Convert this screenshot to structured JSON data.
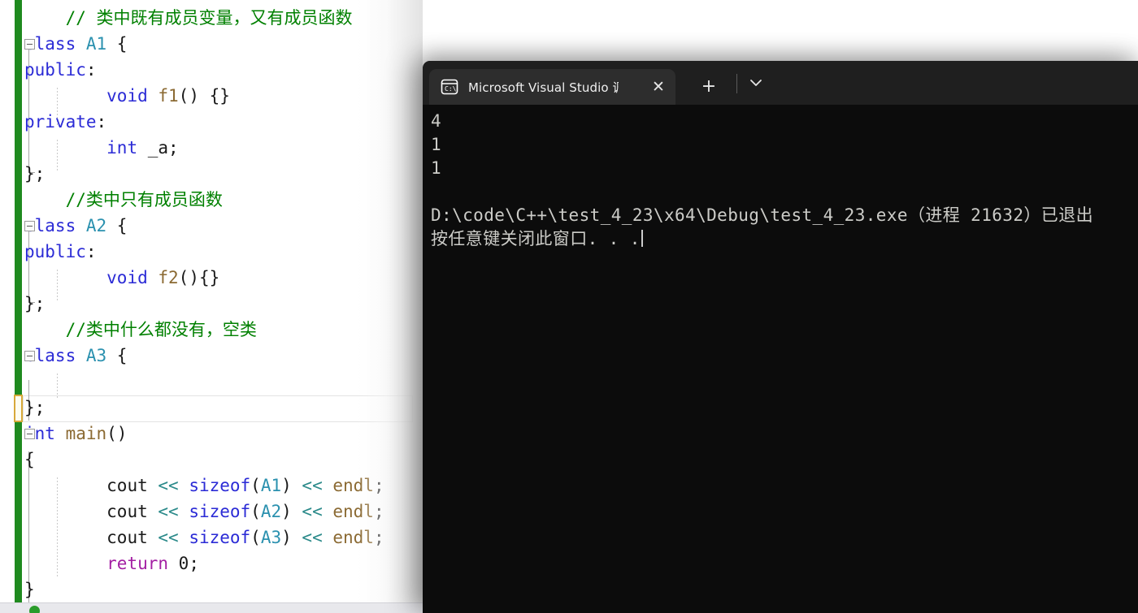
{
  "editor": {
    "name": "visual-studio-code-editor",
    "language": "cpp",
    "lines": [
      {
        "indent": 1,
        "tokens": [
          {
            "t": "// 类中既有成员变量，又有成员函数",
            "c": "t-comment"
          }
        ]
      },
      {
        "indent": 0,
        "fold": true,
        "tokens": [
          {
            "t": "class ",
            "c": "t-keyword"
          },
          {
            "t": "A1",
            "c": "t-class"
          },
          {
            "t": " {",
            "c": "t-brace"
          }
        ]
      },
      {
        "indent": 0,
        "tokens": [
          {
            "t": "public",
            "c": "t-keyword"
          },
          {
            "t": ":",
            "c": "t-plain"
          }
        ]
      },
      {
        "indent": 2,
        "tokens": [
          {
            "t": "void ",
            "c": "t-type"
          },
          {
            "t": "f1",
            "c": "t-func"
          },
          {
            "t": "() {}",
            "c": "t-brace"
          }
        ]
      },
      {
        "indent": 0,
        "tokens": [
          {
            "t": "private",
            "c": "t-keyword"
          },
          {
            "t": ":",
            "c": "t-plain"
          }
        ]
      },
      {
        "indent": 2,
        "tokens": [
          {
            "t": "int ",
            "c": "t-type"
          },
          {
            "t": "_a;",
            "c": "t-ident"
          }
        ]
      },
      {
        "indent": 0,
        "tokens": [
          {
            "t": "};",
            "c": "t-brace"
          }
        ]
      },
      {
        "indent": 1,
        "tokens": [
          {
            "t": "//类中只有成员函数",
            "c": "t-comment"
          }
        ]
      },
      {
        "indent": 0,
        "fold": true,
        "tokens": [
          {
            "t": "class ",
            "c": "t-keyword"
          },
          {
            "t": "A2",
            "c": "t-class"
          },
          {
            "t": " {",
            "c": "t-brace"
          }
        ]
      },
      {
        "indent": 0,
        "tokens": [
          {
            "t": "public",
            "c": "t-keyword"
          },
          {
            "t": ":",
            "c": "t-plain"
          }
        ]
      },
      {
        "indent": 2,
        "tokens": [
          {
            "t": "void ",
            "c": "t-type"
          },
          {
            "t": "f2",
            "c": "t-func"
          },
          {
            "t": "(){}",
            "c": "t-brace"
          }
        ]
      },
      {
        "indent": 0,
        "tokens": [
          {
            "t": "};",
            "c": "t-brace"
          }
        ]
      },
      {
        "indent": 1,
        "tokens": [
          {
            "t": "//类中什么都没有，空类",
            "c": "t-comment"
          }
        ]
      },
      {
        "indent": 0,
        "fold": true,
        "tokens": [
          {
            "t": "class ",
            "c": "t-keyword"
          },
          {
            "t": "A3",
            "c": "t-class"
          },
          {
            "t": " {",
            "c": "t-brace"
          }
        ]
      },
      {
        "indent": 0,
        "tokens": [
          {
            "t": "",
            "c": "t-plain"
          }
        ]
      },
      {
        "indent": 0,
        "current": true,
        "tokens": [
          {
            "t": "};",
            "c": "t-brace"
          }
        ]
      },
      {
        "indent": 0,
        "fold": true,
        "tokens": [
          {
            "t": "int ",
            "c": "t-type"
          },
          {
            "t": "main",
            "c": "t-func"
          },
          {
            "t": "()",
            "c": "t-brace"
          }
        ]
      },
      {
        "indent": 0,
        "tokens": [
          {
            "t": "{",
            "c": "t-brace"
          }
        ]
      },
      {
        "indent": 2,
        "tokens": [
          {
            "t": "cout ",
            "c": "t-plain"
          },
          {
            "t": "<< ",
            "c": "t-op"
          },
          {
            "t": "sizeof",
            "c": "t-keyword"
          },
          {
            "t": "(",
            "c": "t-brace"
          },
          {
            "t": "A1",
            "c": "t-class"
          },
          {
            "t": ") ",
            "c": "t-brace"
          },
          {
            "t": "<< ",
            "c": "t-op"
          },
          {
            "t": "endl",
            "c": "t-endl"
          },
          {
            "t": ";",
            "c": "t-plain"
          }
        ]
      },
      {
        "indent": 2,
        "tokens": [
          {
            "t": "cout ",
            "c": "t-plain"
          },
          {
            "t": "<< ",
            "c": "t-op"
          },
          {
            "t": "sizeof",
            "c": "t-keyword"
          },
          {
            "t": "(",
            "c": "t-brace"
          },
          {
            "t": "A2",
            "c": "t-class"
          },
          {
            "t": ") ",
            "c": "t-brace"
          },
          {
            "t": "<< ",
            "c": "t-op"
          },
          {
            "t": "endl",
            "c": "t-endl"
          },
          {
            "t": ";",
            "c": "t-plain"
          }
        ]
      },
      {
        "indent": 2,
        "tokens": [
          {
            "t": "cout ",
            "c": "t-plain"
          },
          {
            "t": "<< ",
            "c": "t-op"
          },
          {
            "t": "sizeof",
            "c": "t-keyword"
          },
          {
            "t": "(",
            "c": "t-brace"
          },
          {
            "t": "A3",
            "c": "t-class"
          },
          {
            "t": ") ",
            "c": "t-brace"
          },
          {
            "t": "<< ",
            "c": "t-op"
          },
          {
            "t": "endl",
            "c": "t-endl"
          },
          {
            "t": ";",
            "c": "t-plain"
          }
        ]
      },
      {
        "indent": 2,
        "tokens": [
          {
            "t": "return ",
            "c": "t-return"
          },
          {
            "t": "0;",
            "c": "t-ident"
          }
        ]
      },
      {
        "indent": 0,
        "tokens": [
          {
            "t": "}",
            "c": "t-brace"
          }
        ]
      }
    ],
    "statusbar": {
      "indicator_label": "",
      "text": "",
      "right_text": ""
    },
    "colors": {
      "comment": "#008000",
      "keyword": "#2b2bd6",
      "class_name": "#2b91af",
      "function": "#8b6a33",
      "operator": "#2b8a8a",
      "return_keyword": "#a31fa3",
      "saved_change_margin": "#1f8a1f",
      "unsaved_change_margin": "#d8a93a"
    }
  },
  "console": {
    "name": "microsoft-visual-studio-debug-console",
    "tab": {
      "title": "Microsoft Visual Studio 调试控",
      "icon": "console-icon",
      "close_label": "✕"
    },
    "toolbar": {
      "new_tab_label": "+",
      "dropdown_label": "⌄"
    },
    "output_lines": [
      "4",
      "1",
      "1",
      "",
      "D:\\code\\C++\\test_4_23\\x64\\Debug\\test_4_23.exe（进程 21632）已退出",
      "按任意键关闭此窗口. . ."
    ],
    "colors": {
      "background": "#0c0c0c",
      "titlebar": "#1f1f1f",
      "tab_active": "#2d2d2d",
      "text": "#ccccc8"
    }
  }
}
